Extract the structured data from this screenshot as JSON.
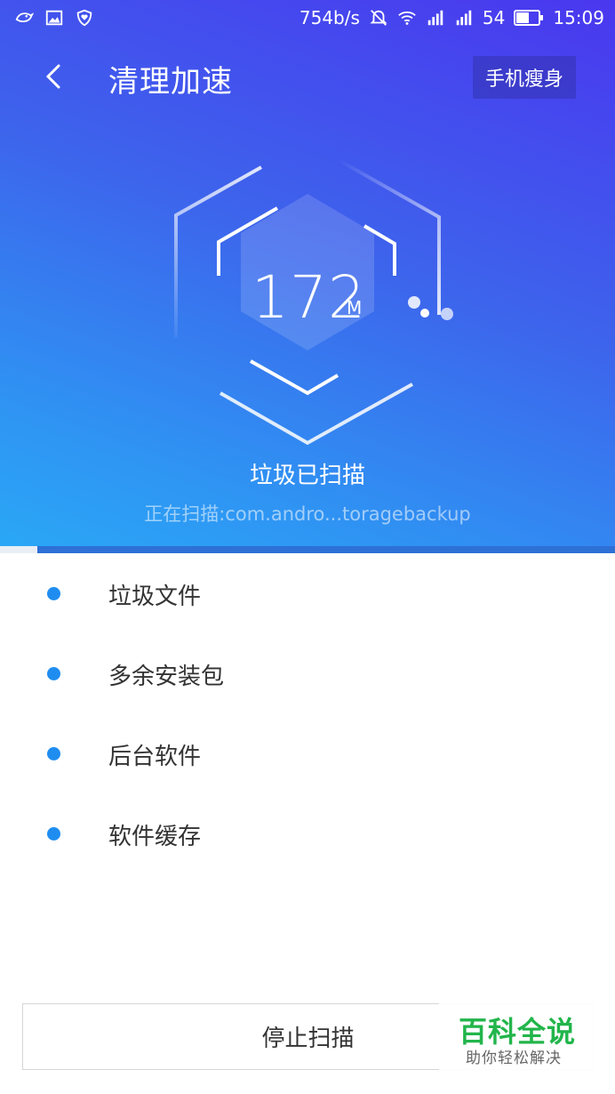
{
  "status_bar": {
    "speed": "754b/s",
    "battery_level": "54",
    "time": "15:09",
    "icons": [
      "bird-icon",
      "image-icon",
      "shield-heart-icon",
      "mute-icon",
      "wifi-icon",
      "signal-icon",
      "signal-icon",
      "battery-icon"
    ]
  },
  "header": {
    "title": "清理加速",
    "slim_button": "手机瘦身"
  },
  "scan": {
    "size_value": "172",
    "size_unit": "M",
    "status": "垃圾已扫描",
    "current_path": "正在扫描:com.andro...toragebackup",
    "progress": 0.06
  },
  "categories": [
    {
      "label": "垃圾文件"
    },
    {
      "label": "多余安装包"
    },
    {
      "label": "后台软件"
    },
    {
      "label": "软件缓存"
    }
  ],
  "footer": {
    "stop_button": "停止扫描"
  },
  "watermark": {
    "main": "百科全说",
    "sub": "助你轻松解决"
  },
  "colors": {
    "accent": "#1f8df0",
    "hero_top": "#4a37ef",
    "hero_bottom": "#2aa8f6",
    "watermark_green": "#22b54b"
  }
}
